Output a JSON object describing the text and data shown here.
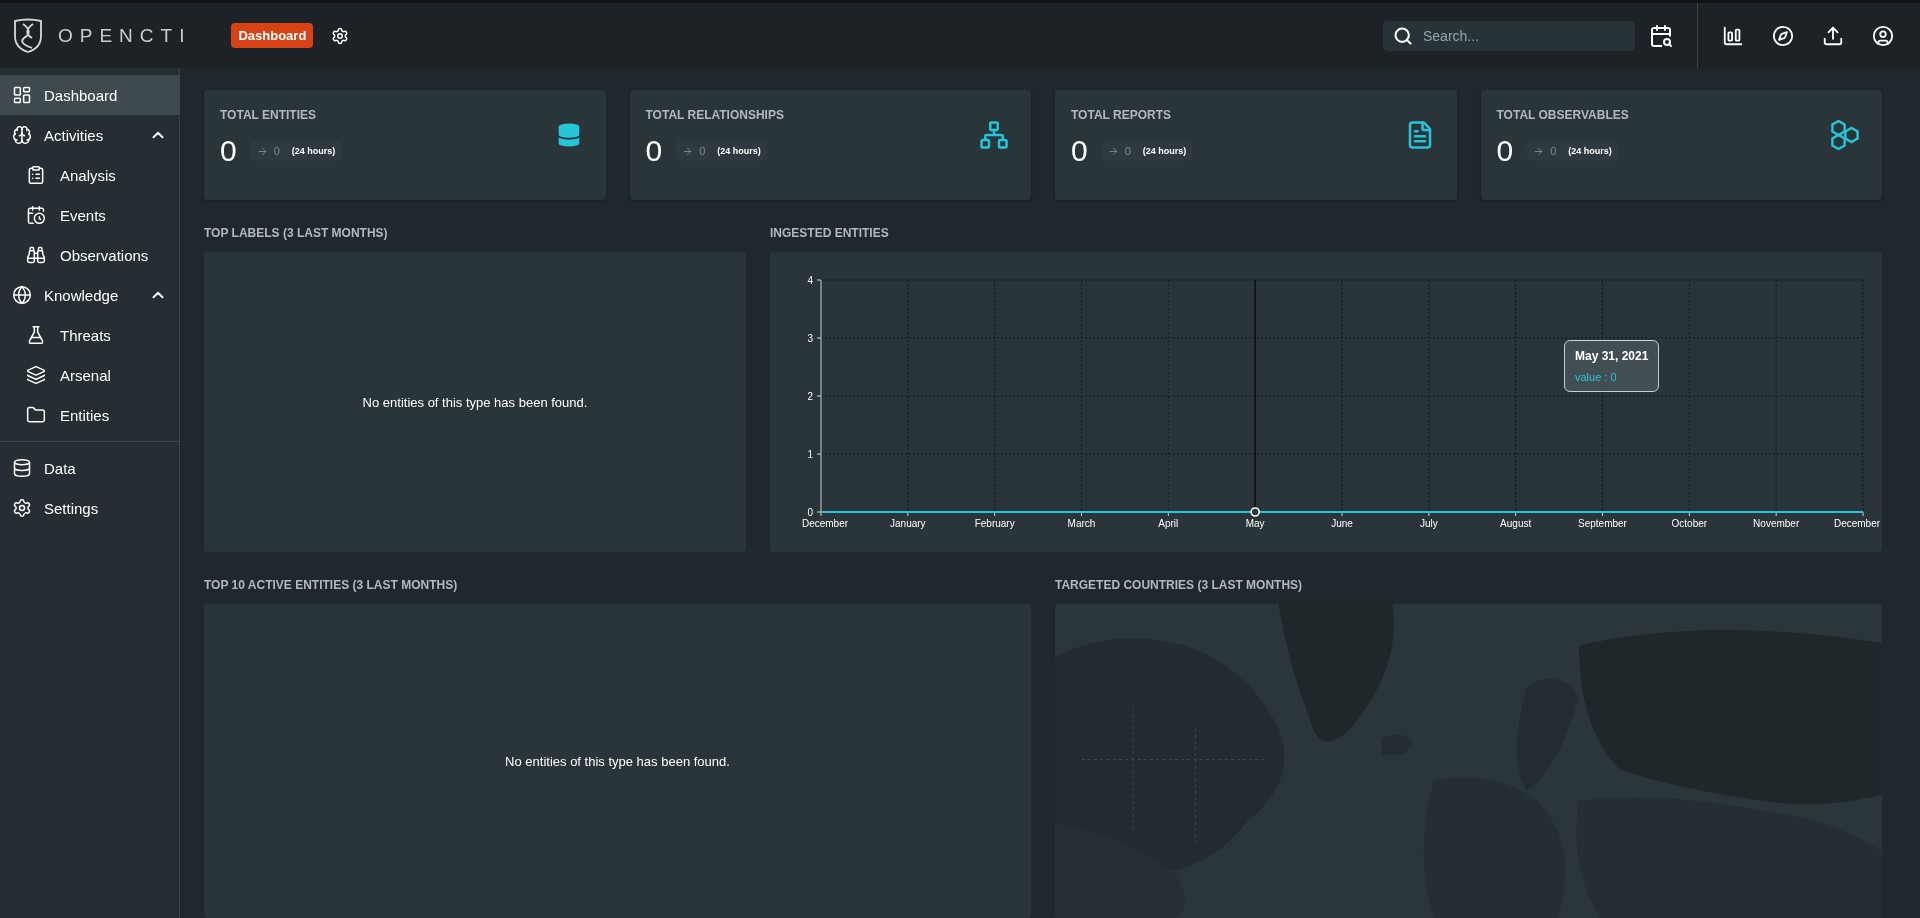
{
  "header": {
    "logo_text": "OPENCTI",
    "page_badge": "Dashboard",
    "search": {
      "placeholder": "Search..."
    }
  },
  "sidebar": {
    "sections": [
      {
        "items": [
          {
            "label": "Dashboard",
            "selected": true
          },
          {
            "label": "Activities",
            "selected": false,
            "expanded": true,
            "children": [
              {
                "label": "Analysis",
                "selected": false
              },
              {
                "label": "Events",
                "selected": false
              },
              {
                "label": "Observations",
                "selected": false
              }
            ]
          },
          {
            "label": "Knowledge",
            "selected": false,
            "expanded": true,
            "children": [
              {
                "label": "Threats",
                "selected": false
              },
              {
                "label": "Arsenal",
                "selected": false
              },
              {
                "label": "Entities",
                "selected": false
              }
            ]
          }
        ]
      },
      {
        "items": [
          {
            "label": "Data",
            "selected": false
          },
          {
            "label": "Settings",
            "selected": false
          }
        ]
      }
    ]
  },
  "stats": [
    {
      "title": "TOTAL ENTITIES",
      "value": "0",
      "delta": "0",
      "period": "(24 hours)"
    },
    {
      "title": "TOTAL RELATIONSHIPS",
      "value": "0",
      "delta": "0",
      "period": "(24 hours)"
    },
    {
      "title": "TOTAL REPORTS",
      "value": "0",
      "delta": "0",
      "period": "(24 hours)"
    },
    {
      "title": "TOTAL OBSERVABLES",
      "value": "0",
      "delta": "0",
      "period": "(24 hours)"
    }
  ],
  "top_labels": {
    "title": "TOP LABELS (3 LAST MONTHS)",
    "empty_message": "No entities of this type has been found."
  },
  "ingested_entities": {
    "title": "INGESTED ENTITIES",
    "chart_data": {
      "type": "line",
      "categories": [
        "December",
        "January",
        "February",
        "March",
        "April",
        "May",
        "June",
        "July",
        "August",
        "September",
        "October",
        "November",
        "December"
      ],
      "series": [
        {
          "color": "#26c6da",
          "values": [
            0,
            0,
            0,
            0,
            0,
            0,
            0,
            0,
            0,
            0,
            0,
            0,
            0
          ]
        }
      ],
      "ylim": [
        0,
        4
      ],
      "yticks": [
        0,
        1,
        2,
        3,
        4
      ],
      "grid": true,
      "ref_lines": [
        {
          "axis": "x",
          "value": "May",
          "color": "#0d1214"
        }
      ]
    },
    "tooltip": {
      "date": "May 31, 2021",
      "value": "value : 0"
    }
  },
  "top_active_entities": {
    "title": "TOP 10 ACTIVE ENTITIES (3 LAST MONTHS)",
    "empty_message": "No entities of this type has been found."
  },
  "targeted_countries": {
    "title": "TARGETED COUNTRIES (3 LAST MONTHS)"
  }
}
